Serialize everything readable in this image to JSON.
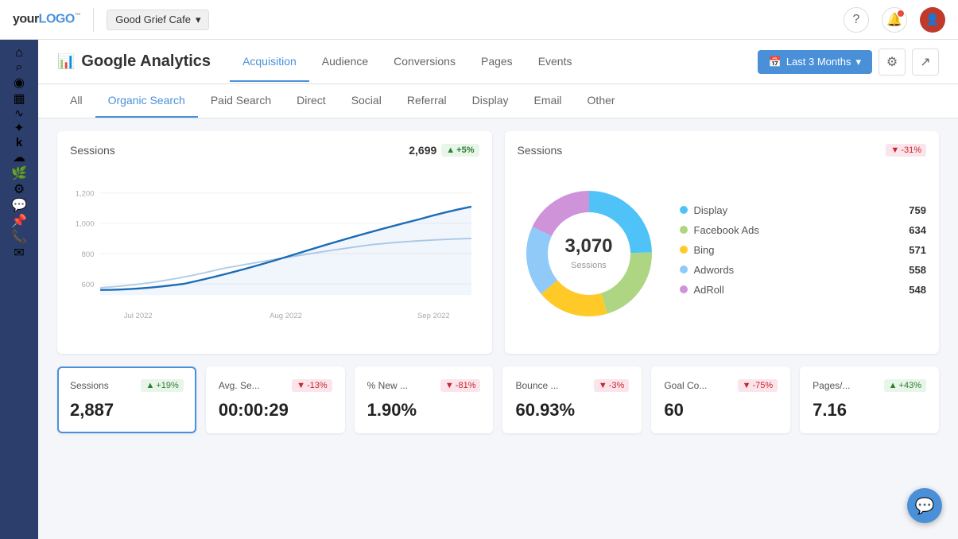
{
  "topbar": {
    "logo": "yourLOGO™",
    "workspace": "Good Grief Cafe",
    "workspace_arrow": "▾",
    "help_icon": "?",
    "notification_icon": "🔔",
    "avatar_initial": "👤"
  },
  "sidebar": {
    "icons": [
      {
        "name": "home-icon",
        "symbol": "⌂",
        "active": false
      },
      {
        "name": "search-icon",
        "symbol": "⌕",
        "active": false
      },
      {
        "name": "analytics-icon",
        "symbol": "◉",
        "active": true
      },
      {
        "name": "bar-chart-icon",
        "symbol": "▦",
        "active": false
      },
      {
        "name": "chart2-icon",
        "symbol": "∿",
        "active": false
      },
      {
        "name": "integrations-icon",
        "symbol": "✦",
        "active": false
      },
      {
        "name": "klipfolio-icon",
        "symbol": "k",
        "active": false
      },
      {
        "name": "salesforce-icon",
        "symbol": "☁",
        "active": false
      },
      {
        "name": "leaf-icon",
        "symbol": "🌿",
        "active": false
      },
      {
        "name": "settings-icon",
        "symbol": "⚙",
        "active": false
      },
      {
        "name": "comments-icon",
        "symbol": "💬",
        "active": false
      },
      {
        "name": "pin-icon",
        "symbol": "📌",
        "active": false
      },
      {
        "name": "phone-icon",
        "symbol": "📞",
        "active": false
      },
      {
        "name": "mail-icon",
        "symbol": "✉",
        "active": false
      }
    ]
  },
  "analytics_header": {
    "title": "Google Analytics",
    "bar_icon": "📊",
    "nav_tabs": [
      {
        "label": "Acquisition",
        "active": true
      },
      {
        "label": "Audience",
        "active": false
      },
      {
        "label": "Conversions",
        "active": false
      },
      {
        "label": "Pages",
        "active": false
      },
      {
        "label": "Events",
        "active": false
      }
    ],
    "date_range": "Last 3 Months",
    "filter_icon": "⚙",
    "share_icon": "↗"
  },
  "sub_tabs": [
    {
      "label": "All",
      "active": false
    },
    {
      "label": "Organic Search",
      "active": true
    },
    {
      "label": "Paid Search",
      "active": false
    },
    {
      "label": "Direct",
      "active": false
    },
    {
      "label": "Social",
      "active": false
    },
    {
      "label": "Referral",
      "active": false
    },
    {
      "label": "Display",
      "active": false
    },
    {
      "label": "Email",
      "active": false
    },
    {
      "label": "Other",
      "active": false
    }
  ],
  "line_chart": {
    "title": "Sessions",
    "value": "2,699",
    "change": "+5%",
    "change_type": "up",
    "y_labels": [
      "1,200",
      "1,000",
      "800",
      "600"
    ],
    "x_labels": [
      "Jul 2022",
      "Aug 2022",
      "Sep 2022"
    ]
  },
  "donut_chart": {
    "title": "Sessions",
    "change": "-31%",
    "change_type": "down",
    "total": "3,070",
    "total_label": "Sessions",
    "legend": [
      {
        "name": "Display",
        "count": "759",
        "color": "#4fc3f7"
      },
      {
        "name": "Facebook Ads",
        "count": "634",
        "color": "#aed581"
      },
      {
        "name": "Bing",
        "count": "571",
        "color": "#ffca28"
      },
      {
        "name": "Adwords",
        "count": "558",
        "color": "#90caf9"
      },
      {
        "name": "AdRoll",
        "count": "548",
        "color": "#ce93d8"
      }
    ],
    "segments": [
      {
        "name": "Display",
        "color": "#4fc3f7",
        "pct": 24.7
      },
      {
        "name": "Facebook Ads",
        "color": "#aed581",
        "pct": 20.6
      },
      {
        "name": "Bing",
        "color": "#ffca28",
        "pct": 18.6
      },
      {
        "name": "Adwords",
        "color": "#90caf9",
        "pct": 18.2
      },
      {
        "name": "AdRoll",
        "color": "#ce93d8",
        "pct": 17.9
      }
    ]
  },
  "stats": [
    {
      "label": "Sessions",
      "value": "2,887",
      "change": "+19%",
      "change_type": "up",
      "selected": true
    },
    {
      "label": "Avg. Se...",
      "value": "00:00:29",
      "change": "-13%",
      "change_type": "down",
      "selected": false
    },
    {
      "label": "% New ...",
      "value": "1.90%",
      "change": "-81%",
      "change_type": "down",
      "selected": false
    },
    {
      "label": "Bounce ...",
      "value": "60.93%",
      "change": "-3%",
      "change_type": "down",
      "selected": false
    },
    {
      "label": "Goal Co...",
      "value": "60",
      "change": "-75%",
      "change_type": "down",
      "selected": false
    },
    {
      "label": "Pages/...",
      "value": "7.16",
      "change": "+43%",
      "change_type": "up",
      "selected": false
    }
  ],
  "colors": {
    "primary": "#4a90d9",
    "up": "#2e7d32",
    "down": "#c62828",
    "up_bg": "#e8f5e9",
    "down_bg": "#fce4ec"
  }
}
